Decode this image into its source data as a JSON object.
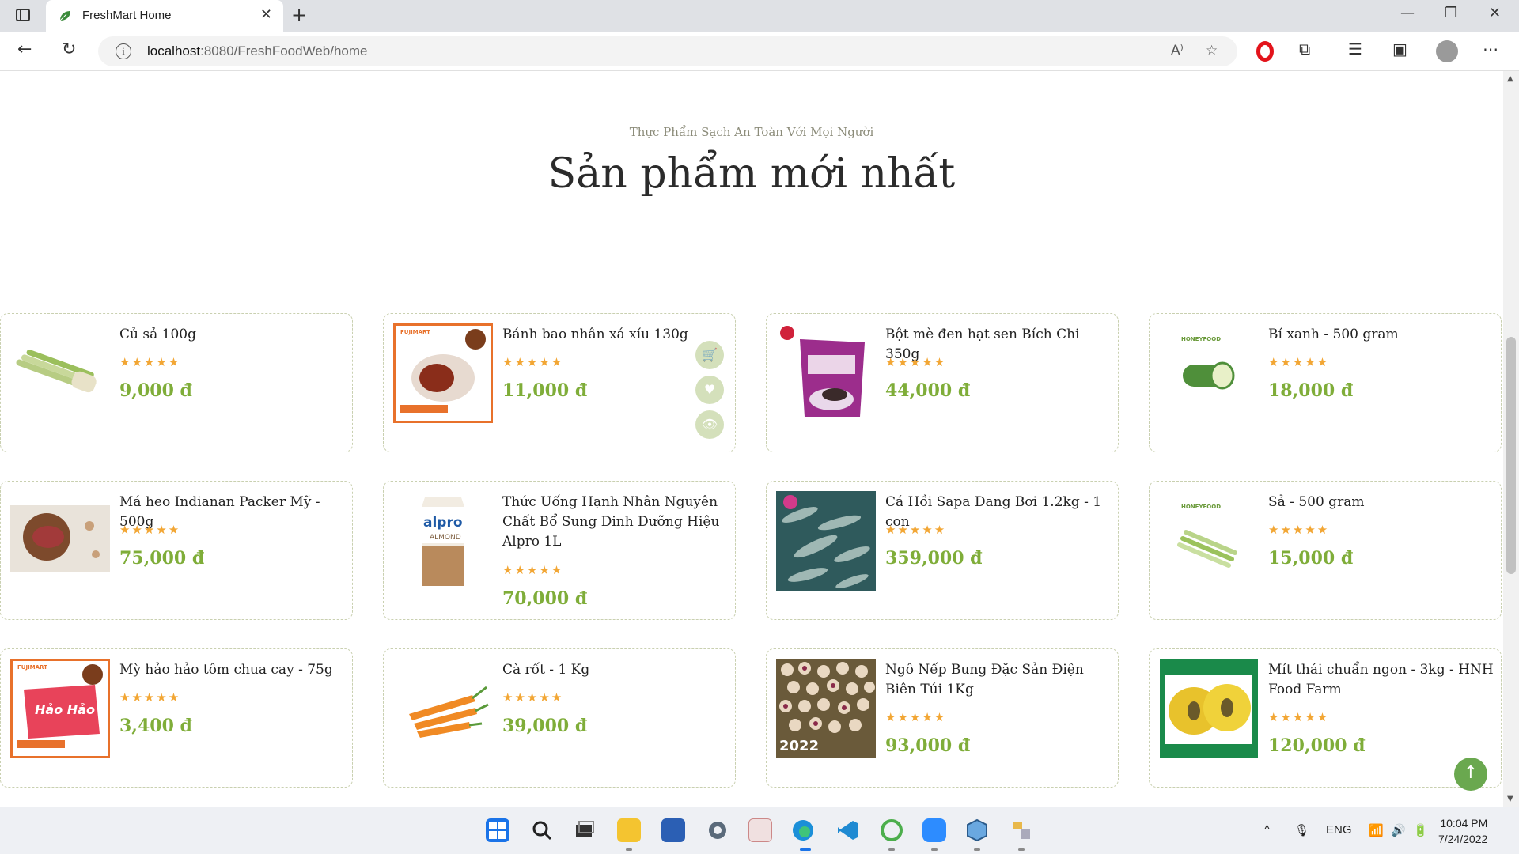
{
  "browser": {
    "tab_title": "FreshMart Home",
    "url_host": "localhost",
    "url_rest": ":8080/FreshFoodWeb/home",
    "close_tab": "✕",
    "new_tab": "+",
    "min": "—",
    "restore": "❐",
    "close_win": "✕",
    "back": "←",
    "reload": "↻",
    "more": "⋯"
  },
  "section": {
    "subtitle": "Thực Phẩm Sạch An Toàn Với Mọi Người",
    "title": "Sản phẩm mới nhất"
  },
  "stars": "★★★★★",
  "products": [
    {
      "name": "Củ sả 100g",
      "price": "9,000 đ"
    },
    {
      "name": "Bánh bao nhân xá xíu 130g",
      "price": "11,000 đ"
    },
    {
      "name": "Bột mè đen hạt sen Bích Chi 350g",
      "price": "44,000 đ"
    },
    {
      "name": "Bí xanh - 500 gram",
      "price": "18,000 đ"
    },
    {
      "name": "Má heo Indianan Packer Mỹ - 500g",
      "price": "75,000 đ"
    },
    {
      "name": "Thức Uống Hạnh Nhân Nguyên Chất Bổ Sung Dinh Dưỡng Hiệu Alpro 1L",
      "price": "70,000 đ"
    },
    {
      "name": "Cá Hồi Sapa Đang Bơi 1.2kg - 1 con",
      "price": "359,000 đ"
    },
    {
      "name": "Sả - 500 gram",
      "price": "15,000 đ"
    },
    {
      "name": "Mỳ hảo hảo tôm chua cay - 75g",
      "price": "3,400 đ"
    },
    {
      "name": "Cà rốt - 1 Kg",
      "price": "39,000 đ"
    },
    {
      "name": "Ngô Nếp Bung Đặc Sản Điện Biên Túi 1Kg",
      "price": "93,000 đ"
    },
    {
      "name": "Mít thái chuẩn ngon - 3kg - HNH Food Farm",
      "price": "120,000 đ"
    }
  ],
  "image_text": {
    "alpro": "alpro",
    "almond": "ALMOND",
    "honeyfood": "HONEYFOOD",
    "haohao": "Hảo Hảo",
    "fujimart": "FUJIMART",
    "corn_year": "2022"
  },
  "card_actions": {
    "cart": "🛒",
    "heart": "♥",
    "view": "👁"
  },
  "to_top": "↑",
  "taskbar": {
    "lang": "ENG",
    "time": "10:04 PM",
    "date": "7/24/2022"
  },
  "colors": {
    "accent_green": "#7fad39",
    "star": "#f2a634",
    "card_border": "#c9d0b0"
  }
}
